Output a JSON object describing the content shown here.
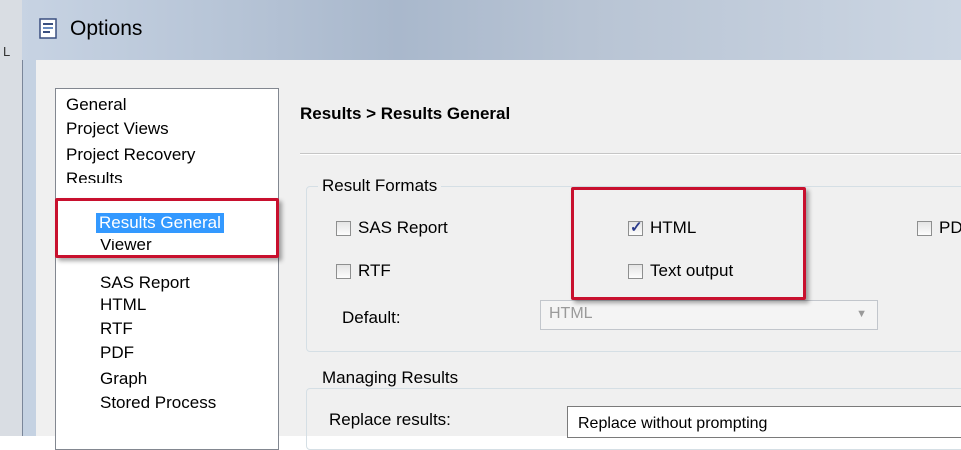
{
  "window": {
    "title": "Options"
  },
  "nav": {
    "items": [
      {
        "label": "General",
        "level": 0
      },
      {
        "label": "Project Views",
        "level": 0
      },
      {
        "label": "Project Recovery",
        "level": 0
      },
      {
        "label": "Results",
        "level": 0
      },
      {
        "label": "Results General",
        "level": 1,
        "selected": true
      },
      {
        "label": "Viewer",
        "level": 1
      },
      {
        "label": "SAS Report",
        "level": 1
      },
      {
        "label": "HTML",
        "level": 1
      },
      {
        "label": "RTF",
        "level": 1
      },
      {
        "label": "PDF",
        "level": 1
      },
      {
        "label": "Graph",
        "level": 1
      },
      {
        "label": "Stored Process",
        "level": 1
      }
    ]
  },
  "pane": {
    "title": "Results > Results General",
    "result_formats": {
      "legend": "Result Formats",
      "options": [
        {
          "label": "SAS Report",
          "checked": false
        },
        {
          "label": "HTML",
          "checked": true
        },
        {
          "label": "PDF",
          "checked": false
        },
        {
          "label": "RTF",
          "checked": false
        },
        {
          "label": "Text output",
          "checked": false
        }
      ],
      "default_label": "Default:",
      "default_value": "HTML"
    },
    "managing_results": {
      "legend": "Managing Results",
      "replace_label": "Replace results:",
      "replace_value": "Replace without prompting"
    }
  },
  "colors": {
    "selection": "#3399ff",
    "annotation": "#c8102e"
  }
}
